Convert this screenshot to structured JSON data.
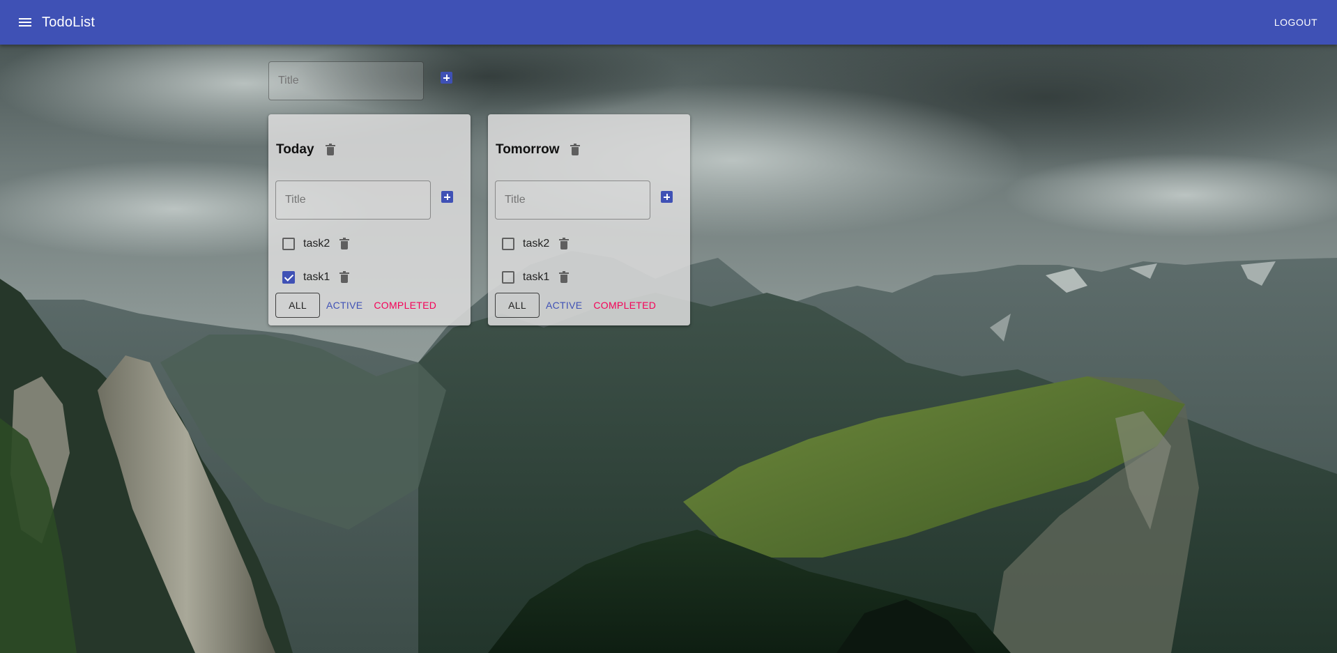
{
  "appbar": {
    "title": "TodoList",
    "logout_label": "LOGOUT",
    "menu_icon": "menu-icon",
    "color": "#3f51b5"
  },
  "new_list": {
    "placeholder": "Title",
    "add_icon": "plus-icon"
  },
  "lists": [
    {
      "title": "Today",
      "input_placeholder": "Title",
      "tasks": [
        {
          "label": "task2",
          "checked": false
        },
        {
          "label": "task1",
          "checked": true
        }
      ],
      "filters": {
        "all": "ALL",
        "active": "ACTIVE",
        "completed": "COMPLETED",
        "selected": "ALL"
      }
    },
    {
      "title": "Tomorrow",
      "input_placeholder": "Title",
      "tasks": [
        {
          "label": "task2",
          "checked": false
        },
        {
          "label": "task1",
          "checked": false
        }
      ],
      "filters": {
        "all": "ALL",
        "active": "ACTIVE",
        "completed": "COMPLETED",
        "selected": "ALL"
      }
    }
  ],
  "colors": {
    "primary": "#3f51b5",
    "secondary": "#f50057"
  }
}
